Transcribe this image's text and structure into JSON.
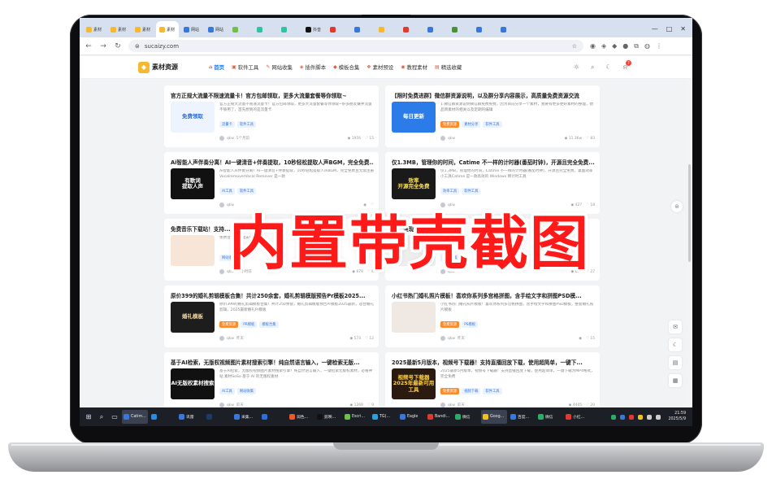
{
  "browser": {
    "tabs": [
      {
        "label": "素材",
        "fav": "#f5b82e"
      },
      {
        "label": "素材",
        "fav": "#f5b82e"
      },
      {
        "label": "素材",
        "fav": "#f5b82e"
      },
      {
        "label": "素材",
        "fav": "#f5b82e",
        "active": true
      },
      {
        "label": "网站",
        "fav": "#3a78d8"
      },
      {
        "label": "网站",
        "fav": "#3a78d8"
      },
      {
        "label": "",
        "fav": "#6fbf4a"
      },
      {
        "label": "",
        "fav": "#35c0a0"
      },
      {
        "label": "",
        "fav": "#35c0a0"
      },
      {
        "label": "抖音",
        "fav": "#111111"
      },
      {
        "label": "",
        "fav": "#e03a2f"
      },
      {
        "label": "",
        "fav": "#3a78d8"
      },
      {
        "label": "",
        "fav": "#f5b82e"
      },
      {
        "label": "",
        "fav": "#e03a2f"
      },
      {
        "label": "",
        "fav": "#3a78d8"
      },
      {
        "label": "",
        "fav": "#4a8f3a"
      },
      {
        "label": "",
        "fav": "#3a78d8"
      },
      {
        "label": "",
        "fav": "#3a78d8"
      }
    ],
    "url": "sucaizy.com"
  },
  "site": {
    "logo": "素材资源",
    "nav": [
      {
        "label": "首页",
        "active": true
      },
      {
        "label": "软件工具"
      },
      {
        "label": "网站收集"
      },
      {
        "label": "插件脚本"
      },
      {
        "label": "模板合集"
      },
      {
        "label": "素材预设"
      },
      {
        "label": "教程素材"
      },
      {
        "label": "精选收藏"
      }
    ],
    "notif_count": "7"
  },
  "cards": [
    {
      "title": "官方正规大流量不限速流量卡！官方包邮领取，更多大流量套餐等你领取~",
      "thumb_text": "免费领取",
      "thumb_bg": "#eef4ff",
      "thumb_fg": "#2d6fd8",
      "desc": "官方正规大流量不限速流量卡！官方包邮领取，更多大流量套餐等你领取~好多朋友嫌弃流量不够用了，首先想到的是流量卡",
      "tags": [
        {
          "t": "流量卡"
        },
        {
          "t": "软件工具"
        }
      ],
      "author": "qkw",
      "time": "5个月前",
      "views": "1956",
      "likes": "15"
    },
    {
      "title": "【限时免费进群】微信群资源说明，以及群分享内容展示，高质量免费资源交流",
      "thumb_text": "每日更新",
      "thumb_bg": "#2b7be8",
      "thumb_fg": "#ffffff",
      "desc": "1.微信群资源说明微信群免费免费，因为目前分享一个素材，我要有更多更好素材的整理，想品牌素材的相关以及定期的编辑",
      "tags": [
        {
          "t": "免费资源",
          "hot": true
        },
        {
          "t": "素材分享"
        },
        {
          "t": "软件工具"
        }
      ],
      "author": "qkw",
      "time": "",
      "views": "11.36w",
      "likes": "83"
    },
    {
      "title": "Ai智能人声伴奏分离！AI一键清音+伴奏提取，10秒轻松提取人声BGM，完全免费...",
      "thumb_text": "有歌词\n提取人声",
      "thumb_bg": "#111111",
      "thumb_fg": "#ffffff",
      "desc": "Ai智能人声伴奏分离！AI一键清音+伴奏提取，10秒轻松提取人声BGM，完全免费且无需注册 VocalremoverVocal Remover 是一款",
      "tags": [
        {
          "t": "AI工具"
        },
        {
          "t": "软件工具"
        }
      ],
      "author": "qkw",
      "time": "",
      "views": "",
      "likes": ""
    },
    {
      "title": "仅1.3MB，管理你的时间，Catime 不一样的计时器(番茄时钟)，开源且完全免费...",
      "thumb_text": "效率\n开源完全免费",
      "thumb_bg": "#1a1a1a",
      "thumb_fg": "#ffe04a",
      "desc": "仅1.3MB，管理你的时间，Catime 不一样的计时器(番茄时钟)，开源且完全免费，桌面效率小工具Catime 是一款高效的 Windows 倒计时工具",
      "tags": [
        {
          "t": "效率工具"
        },
        {
          "t": "软件工具"
        }
      ],
      "author": "qkw",
      "time": "",
      "views": "427",
      "likes": "18"
    },
    {
      "title": "免费音乐下载站！支持...",
      "thumb_text": "",
      "thumb_bg": "#f7e6d8",
      "thumb_fg": "#222222",
      "desc": "免费音乐下载站支持全网...",
      "tags": [
        {
          "t": "网站收集"
        }
      ],
      "author": "qkw",
      "time": "23小时前",
      "views": "679",
      "likes": "6"
    },
    {
      "title": "...一键现场生",
      "thumb_text": "",
      "thumb_bg": "#eeeeee",
      "thumb_fg": "#222222",
      "desc": "...现场生...",
      "tags": [
        {
          "t": "软件工具"
        }
      ],
      "author": "qkw",
      "time": "",
      "views": "688",
      "likes": "27"
    },
    {
      "title": "原价399的婚礼剪辑模板合集！共计250余套，婚礼剪辑模版预告Pr模板2025...",
      "thumb_text": "婚礼模板",
      "thumb_bg": "#1d1d1d",
      "thumb_fg": "#f3d9a4",
      "desc": "原价399的婚礼剪辑模板合集！共计250余套，婚礼剪辑模版预告Pr模板2025最新，适合婚礼剪辑，2025最新婚礼Pr模板",
      "tags": [
        {
          "t": "免费资源",
          "hot": true
        },
        {
          "t": "PR模板"
        },
        {
          "t": "模板合集"
        }
      ],
      "author": "qkw",
      "time": "昨天",
      "views": "573",
      "likes": "12"
    },
    {
      "title": "小红书热门婚礼照片模板！喜欢你系列多宫格拼图，含手绘文字和拼图PSD模...",
      "thumb_text": "",
      "thumb_bg": "#f0e8e2",
      "thumb_fg": "#333333",
      "desc": "小红书热门婚礼照片模板！喜欢你系列多宫格拼图，含手绘文字和拼图PSD模板，整套婚礼照片模板",
      "tags": [
        {
          "t": "免费资源",
          "hot": true
        },
        {
          "t": "PS模板"
        }
      ],
      "author": "qkw",
      "time": "昨天",
      "views": "",
      "likes": "15"
    },
    {
      "title": "基于AI检索，无版权视频图片素材搜索引擎！纯自然语言输入，一键检索无版...",
      "thumb_text": "AI无版权素材搜索",
      "thumb_bg": "#111111",
      "thumb_fg": "#ffffff",
      "desc": "基于AI检索，无版权视频图片素材搜索引擎！纯自然语言输入，一键检索无版权素材，必看神站 素材SoSo 基于 AI 的无版权素材",
      "tags": [
        {
          "t": "AI工具"
        },
        {
          "t": "网站收集"
        }
      ],
      "author": "qkw",
      "time": "前天",
      "views": "1269",
      "likes": "9"
    },
    {
      "title": "2025最新5月版本，视频号下载器！支持直播回放下载，使用超简单，一键下...",
      "thumb_text": "视频号下载器\n2025年最新可用工具",
      "thumb_bg": "#2a1a10",
      "thumb_fg": "#ffd23f",
      "desc": "2025最新5月版本，视频号下载器！支持直播回放下载，使用超简单，一键下载为MP4格式，完全免费",
      "tags": [
        {
          "t": "免费资源",
          "hot": true
        },
        {
          "t": "视频下载"
        },
        {
          "t": "软件工具"
        }
      ],
      "author": "qkw",
      "time": "前天",
      "views": "4405",
      "likes": "20"
    }
  ],
  "taskbar": {
    "apps": [
      {
        "label": "Catim...",
        "color": "#3a78d8",
        "active": true
      },
      {
        "label": "",
        "color": "#2a8be0"
      },
      {
        "label": "讯雷",
        "color": "#3a78d8"
      },
      {
        "label": "",
        "color": "#1c3a6a"
      },
      {
        "label": "采集...",
        "color": "#3a78d8"
      },
      {
        "label": "",
        "color": "#2d6fd8"
      },
      {
        "label": "润色...",
        "color": "#e85c2a"
      },
      {
        "label": "剪映...",
        "color": "#111111"
      },
      {
        "label": "Escri...",
        "color": "#6fbf4a"
      },
      {
        "label": "TG(...",
        "color": "#2aa0e0"
      },
      {
        "label": "Eagle",
        "color": "#3a78d8"
      },
      {
        "label": "Bandi...",
        "color": "#e03a2f"
      },
      {
        "label": "微信",
        "color": "#2aae67"
      },
      {
        "label": "Goog...",
        "color": "#f0c020",
        "active": true
      },
      {
        "label": "百度...",
        "color": "#3a78d8"
      },
      {
        "label": "微信",
        "color": "#2aae67"
      },
      {
        "label": "小红...",
        "color": "#e03a2f"
      }
    ],
    "time": "21:59",
    "date": "2025/5/9"
  },
  "overlay_text": "内置带壳截图"
}
